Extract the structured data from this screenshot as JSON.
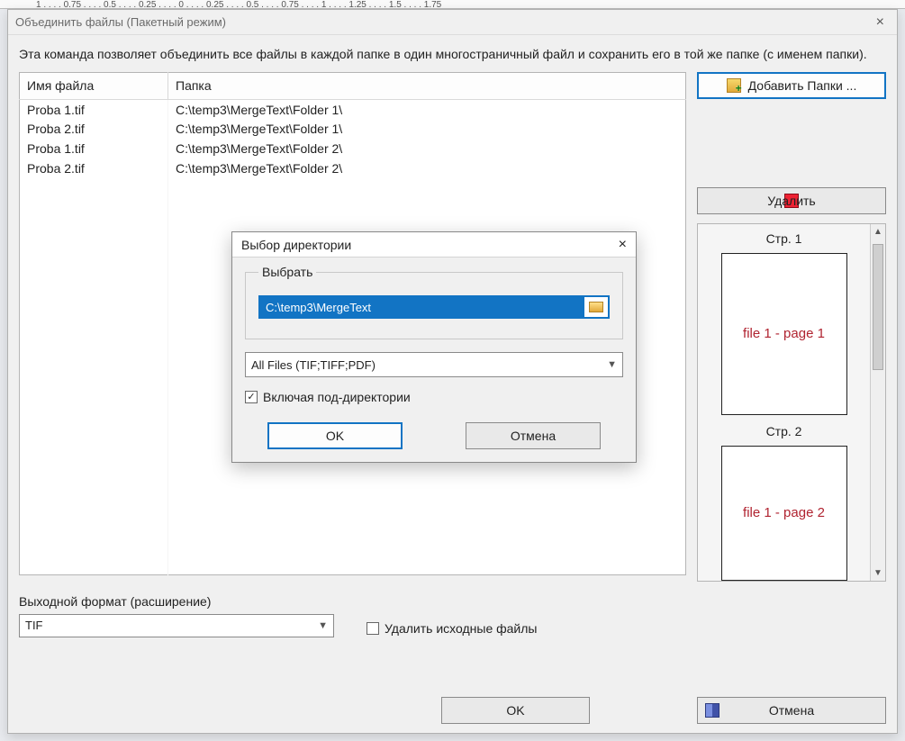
{
  "ruler_text": "1 . . . . 0.75 . . . . 0.5 . . . . 0.25 . . . . 0 . . . . 0.25 . . . . 0.5 . . . . 0.75 . . . . 1 . . . . 1.25 . . . . 1.5 . . . . 1.75",
  "window": {
    "title": "Объединить файлы (Пакетный режим)",
    "close": "×",
    "description": "Эта команда позволяет объединить все файлы в каждой папке в один многостраничный файл и сохранить его в той же папке (с именем папки)."
  },
  "table": {
    "col_filename": "Имя файла",
    "col_folder": "Папка",
    "rows": [
      {
        "name": "Proba 1.tif",
        "folder": "C:\\temp3\\MergeText\\Folder 1\\"
      },
      {
        "name": "Proba 2.tif",
        "folder": "C:\\temp3\\MergeText\\Folder 1\\"
      },
      {
        "name": "Proba 1.tif",
        "folder": "C:\\temp3\\MergeText\\Folder 2\\"
      },
      {
        "name": "Proba 2.tif",
        "folder": "C:\\temp3\\MergeText\\Folder 2\\"
      }
    ]
  },
  "buttons": {
    "add_folders": "Добавить Папки ...",
    "delete": "Удалить",
    "ok": "OK",
    "cancel": "Отмена"
  },
  "preview": {
    "page1_label": "Стр. 1",
    "page1_text": "file 1 - page 1",
    "page2_label": "Стр. 2",
    "page2_text": "file 1 - page 2"
  },
  "output": {
    "label": "Выходной формат (расширение)",
    "value": "TIF",
    "delete_source": "Удалить исходные файлы",
    "delete_source_checked": false
  },
  "modal": {
    "title": "Выбор директории",
    "close": "×",
    "group_label": "Выбрать",
    "path": "C:\\temp3\\MergeText",
    "filter": "All Files (TIF;TIFF;PDF)",
    "subdirs_label": "Включая под-директории",
    "subdirs_checked": true,
    "ok": "OK",
    "cancel": "Отмена"
  }
}
